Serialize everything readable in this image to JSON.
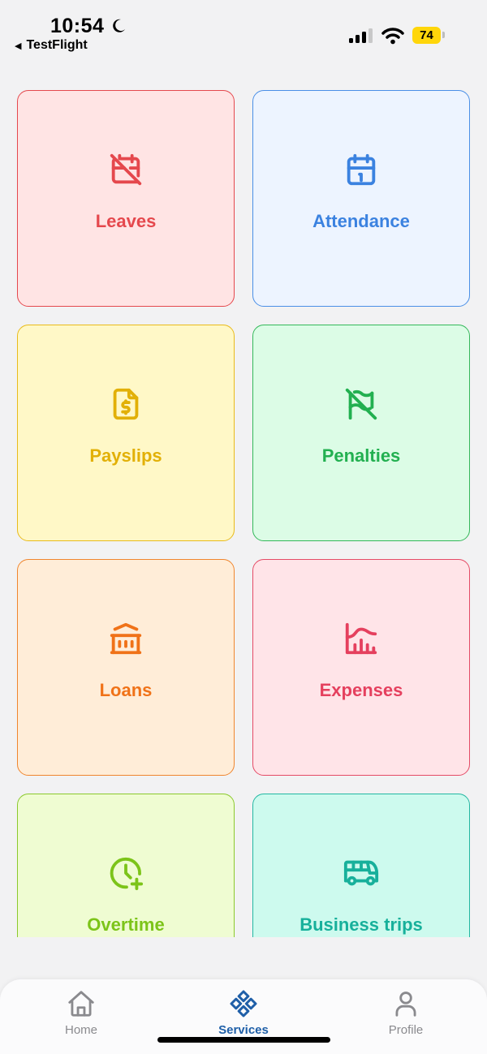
{
  "status_bar": {
    "time": "10:54",
    "back_app": "TestFlight",
    "battery_level": "74",
    "icons": [
      "moon-icon",
      "cellular-signal-icon",
      "wifi-icon",
      "battery-icon"
    ]
  },
  "tiles": [
    {
      "id": "leaves",
      "label": "Leaves",
      "icon": "calendar-off-icon",
      "color": "#e5484d",
      "bg": "#ffe4e4",
      "border": "#e5484d"
    },
    {
      "id": "attendance",
      "label": "Attendance",
      "icon": "calendar-icon",
      "color": "#3b82e0",
      "bg": "#edf4ff",
      "border": "#4a8fe7"
    },
    {
      "id": "payslips",
      "label": "Payslips",
      "icon": "dollar-document-icon",
      "color": "#e2b007",
      "bg": "#fff8c7",
      "border": "#e9bb1a"
    },
    {
      "id": "penalties",
      "label": "Penalties",
      "icon": "flag-off-icon",
      "color": "#22b050",
      "bg": "#dcfce6",
      "border": "#34b85a"
    },
    {
      "id": "loans",
      "label": "Loans",
      "icon": "bank-icon",
      "color": "#f07218",
      "bg": "#ffedd8",
      "border": "#f0862e"
    },
    {
      "id": "expenses",
      "label": "Expenses",
      "icon": "chart-area-icon",
      "color": "#e5405e",
      "bg": "#ffe4e8",
      "border": "#e54b66"
    },
    {
      "id": "overtime",
      "label": "Overtime",
      "icon": "clock-plus-icon",
      "color": "#7cc419",
      "bg": "#effcd2",
      "border": "#8bc92c"
    },
    {
      "id": "business_trips",
      "label": "Business trips",
      "icon": "bus-icon",
      "color": "#17b09b",
      "bg": "#cdfaee",
      "border": "#22b7a2"
    }
  ],
  "tab_bar": {
    "tabs": [
      {
        "label": "Home",
        "icon": "home-icon",
        "active": false
      },
      {
        "label": "Services",
        "icon": "services-icon",
        "active": true
      },
      {
        "label": "Profile",
        "icon": "user-icon",
        "active": false
      }
    ],
    "active_color": "#1f5fa8",
    "inactive_color": "#8a8a8e"
  }
}
